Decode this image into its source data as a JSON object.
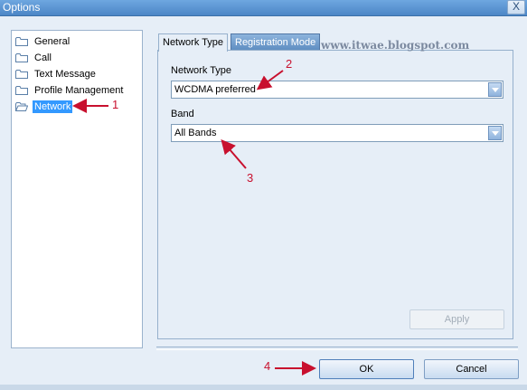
{
  "window": {
    "title": "Options",
    "close_label": "X"
  },
  "tree": {
    "items": [
      {
        "label": "General",
        "selected": false
      },
      {
        "label": "Call",
        "selected": false
      },
      {
        "label": "Text Message",
        "selected": false
      },
      {
        "label": "Profile Management",
        "selected": false
      },
      {
        "label": "Network",
        "selected": true
      }
    ]
  },
  "tabs": [
    {
      "label": "Network Type",
      "active": true
    },
    {
      "label": "Registration Mode",
      "active": false
    }
  ],
  "watermark": "www.itwae.blogspot.com",
  "fields": {
    "network_type": {
      "label": "Network Type",
      "value": "WCDMA preferred"
    },
    "band": {
      "label": "Band",
      "value": "All Bands"
    }
  },
  "buttons": {
    "apply": "Apply",
    "ok": "OK",
    "cancel": "Cancel"
  },
  "annotations": [
    "1",
    "2",
    "3",
    "4"
  ],
  "colors": {
    "annotation": "#c8102e",
    "selection": "#3399ff"
  }
}
